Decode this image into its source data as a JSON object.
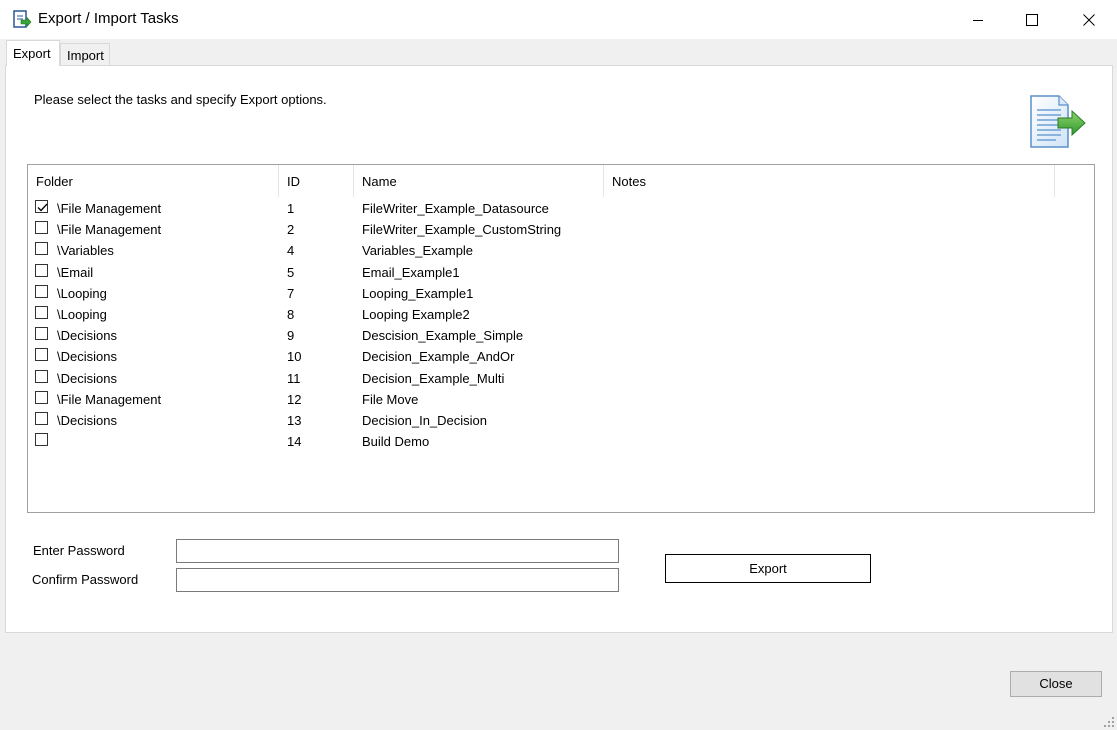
{
  "window": {
    "title": "Export / Import Tasks",
    "icon": "export-document-icon",
    "controls": [
      "minimize-icon",
      "maximize-icon",
      "close-icon"
    ]
  },
  "tabs": [
    {
      "label": "Export",
      "selected": true
    },
    {
      "label": "Import",
      "selected": false
    }
  ],
  "export_tab": {
    "instruction": "Please select the tasks and specify Export options.",
    "header_icon": "document-export-arrow-icon",
    "columns": [
      "Folder",
      "ID",
      "Name",
      "Notes"
    ],
    "rows": [
      {
        "checked": true,
        "folder": "\\File Management",
        "id": "1",
        "name": "FileWriter_Example_Datasource",
        "notes": ""
      },
      {
        "checked": false,
        "folder": "\\File Management",
        "id": "2",
        "name": "FileWriter_Example_CustomString",
        "notes": ""
      },
      {
        "checked": false,
        "folder": "\\Variables",
        "id": "4",
        "name": "Variables_Example",
        "notes": ""
      },
      {
        "checked": false,
        "folder": "\\Email",
        "id": "5",
        "name": "Email_Example1",
        "notes": ""
      },
      {
        "checked": false,
        "folder": "\\Looping",
        "id": "7",
        "name": "Looping_Example1",
        "notes": ""
      },
      {
        "checked": false,
        "folder": "\\Looping",
        "id": "8",
        "name": "Looping Example2",
        "notes": ""
      },
      {
        "checked": false,
        "folder": "\\Decisions",
        "id": "9",
        "name": "Descision_Example_Simple",
        "notes": ""
      },
      {
        "checked": false,
        "folder": "\\Decisions",
        "id": "10",
        "name": "Decision_Example_AndOr",
        "notes": ""
      },
      {
        "checked": false,
        "folder": "\\Decisions",
        "id": "11",
        "name": "Decision_Example_Multi",
        "notes": ""
      },
      {
        "checked": false,
        "folder": "\\File Management",
        "id": "12",
        "name": "File Move",
        "notes": ""
      },
      {
        "checked": false,
        "folder": "\\Decisions",
        "id": "13",
        "name": "Decision_In_Decision",
        "notes": ""
      },
      {
        "checked": false,
        "folder": "",
        "id": "14",
        "name": "Build Demo",
        "notes": ""
      }
    ],
    "password_label": "Enter Password",
    "password_value": "",
    "confirm_label": "Confirm Password",
    "confirm_value": "",
    "export_button": "Export"
  },
  "footer": {
    "close_button": "Close"
  }
}
